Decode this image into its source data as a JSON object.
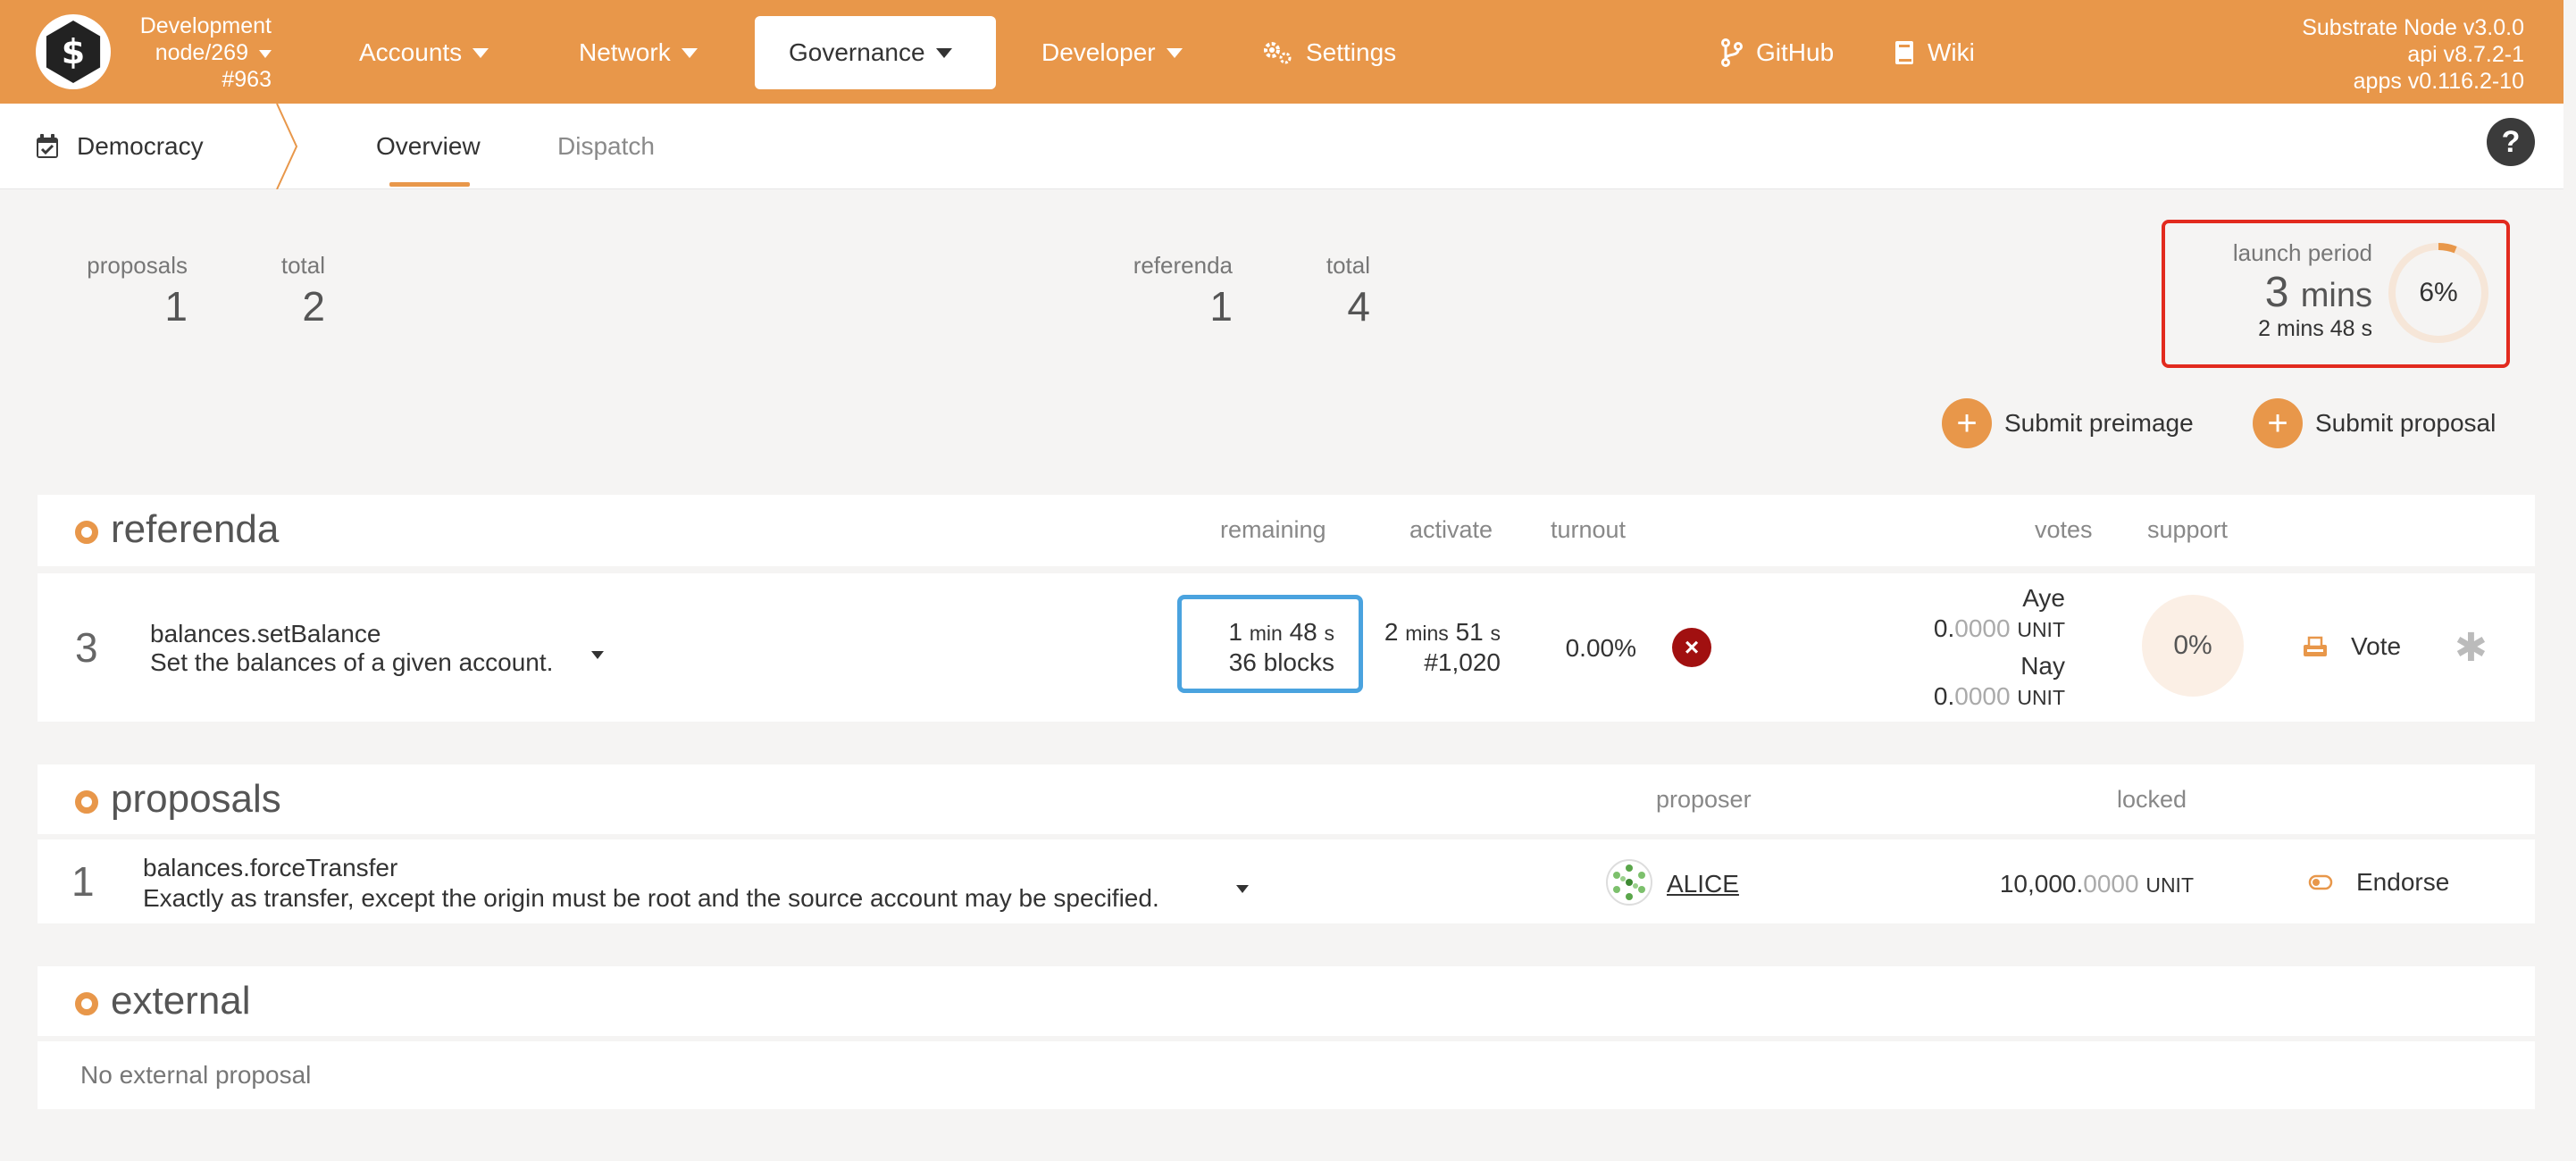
{
  "topbar": {
    "chain": {
      "line1": "Development",
      "line2": "node/269",
      "line3": "#963"
    },
    "nav": [
      {
        "label": "Accounts"
      },
      {
        "label": "Network"
      },
      {
        "label": "Governance"
      },
      {
        "label": "Developer"
      },
      {
        "label": "Settings"
      },
      {
        "label": "GitHub"
      },
      {
        "label": "Wiki"
      }
    ],
    "version": {
      "line1": "Substrate Node v3.0.0",
      "line2": "api v8.7.2-1",
      "line3": "apps v0.116.2-10"
    },
    "colors": {
      "bar": "#e8974a",
      "accent": "#e8974a"
    }
  },
  "subbar": {
    "section": "Democracy",
    "tabs": [
      {
        "label": "Overview"
      },
      {
        "label": "Dispatch"
      }
    ],
    "help": "?"
  },
  "summary": {
    "proposals_label": "proposals",
    "proposals_value": "1",
    "proposals_total_label": "total",
    "proposals_total_value": "2",
    "referenda_label": "referenda",
    "referenda_value": "1",
    "referenda_total_label": "total",
    "referenda_total_value": "4",
    "launch": {
      "label": "launch period",
      "value": "3",
      "unit": "mins",
      "remaining": "2 mins 48 s",
      "percent_label": "6%",
      "percent": 0.06
    }
  },
  "actions": {
    "submit_preimage": "Submit preimage",
    "submit_proposal": "Submit proposal"
  },
  "referenda": {
    "title": "referenda",
    "headers": {
      "remaining": "remaining",
      "activate": "activate",
      "turnout": "turnout",
      "votes": "votes",
      "support": "support"
    },
    "row": {
      "index": "3",
      "method": "balances.setBalance",
      "description": "Set the balances of a given account.",
      "remaining_time_1": "1",
      "remaining_unit_1": "min",
      "remaining_time_2": "48",
      "remaining_unit_2": "s",
      "remaining_blocks": "36 blocks",
      "activate_1": "2",
      "activate_unit_1": "mins",
      "activate_2": "51",
      "activate_unit_2": "s",
      "activate_block": "#1,020",
      "turnout": "0.00%",
      "aye_label": "Aye",
      "aye_int": "0.",
      "aye_dec": "0000",
      "aye_unit": "UNIT",
      "nay_label": "Nay",
      "nay_int": "0.",
      "nay_dec": "0000",
      "nay_unit": "UNIT",
      "support": "0%",
      "vote_label": "Vote"
    }
  },
  "proposals": {
    "title": "proposals",
    "headers": {
      "proposer": "proposer",
      "locked": "locked"
    },
    "row": {
      "index": "1",
      "method": "balances.forceTransfer",
      "description": "Exactly as transfer, except the origin must be root and the source account may be specified.",
      "proposer": "ALICE",
      "locked_int": "10,000.",
      "locked_dec": "0000",
      "locked_unit": "UNIT",
      "endorse_label": "Endorse"
    }
  },
  "external": {
    "title": "external",
    "empty": "No external proposal"
  }
}
